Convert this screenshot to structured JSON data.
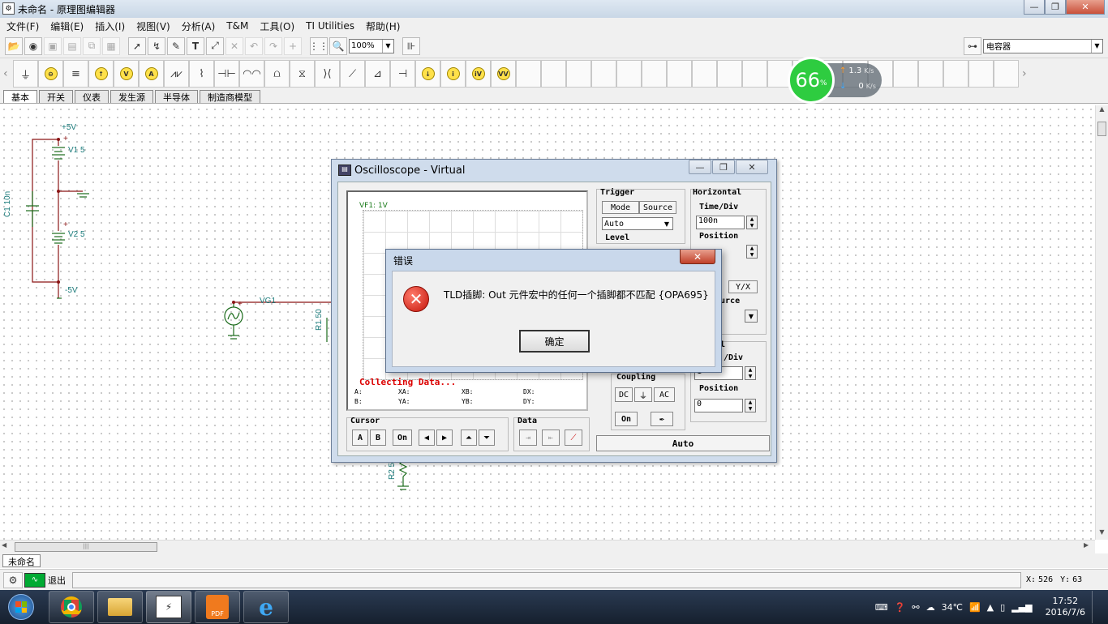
{
  "window": {
    "title": "未命名 - 原理图编辑器"
  },
  "menu": [
    "文件(F)",
    "编辑(E)",
    "插入(I)",
    "视图(V)",
    "分析(A)",
    "T&M",
    "工具(O)",
    "TI Utilities",
    "帮助(H)"
  ],
  "toolbar": {
    "zoom": "100%",
    "search_value": "电容器"
  },
  "component_tabs": [
    "基本",
    "开关",
    "仪表",
    "发生源",
    "半导体",
    "制造商模型"
  ],
  "speed_widget": {
    "percent": "66",
    "percent_sign": "%",
    "up": "1.3",
    "up_unit": "K/s",
    "down": "0",
    "down_unit": "K/s"
  },
  "schematic": {
    "plus5": "+5V",
    "v1": "V1 5",
    "c1": "C1 10n",
    "v2": "V2 5",
    "minus5": "-5V",
    "vg1": "VG1",
    "r1": "R1 50",
    "r2": "R2 5",
    "plus": "+"
  },
  "oscilloscope": {
    "title": "Oscilloscope - Virtual",
    "screen_label": "VF1: 1V",
    "collecting": "Collecting Data...",
    "readouts": {
      "a": "A:",
      "xa": "XA:",
      "xb": "XB:",
      "dx": "DX:",
      "b": "B:",
      "ya": "YA:",
      "yb": "YB:",
      "dy": "DY:"
    },
    "trigger": {
      "label": "Trigger",
      "mode": "Mode",
      "source": "Source",
      "mode_value": "Auto",
      "level": "Level"
    },
    "horizontal": {
      "label": "Horizontal",
      "time_div": "Time/Div",
      "time_value": "100n",
      "position": "Position",
      "yx": "Y/X",
      "source": "ource"
    },
    "vertical": {
      "label": "al",
      "div": "/Div",
      "div_value": "1",
      "position": "Position",
      "position_value": "0"
    },
    "coupling": {
      "label": "Coupling",
      "dc": "DC",
      "gnd": "⏚",
      "ac": "AC",
      "on": "On"
    },
    "cursor": {
      "label": "Cursor",
      "a": "A",
      "b": "B",
      "on": "On"
    },
    "data": {
      "label": "Data"
    },
    "auto": "Auto"
  },
  "error_dialog": {
    "title": "错误",
    "message": "TLD插脚: Out 元件宏中的任何一个插脚都不匹配 {OPA695}",
    "ok": "确定"
  },
  "doc_tab": "未命名",
  "statusbar": {
    "exit": "退出",
    "x_label": "X:",
    "x": "526",
    "y_label": "Y:",
    "y": "63"
  },
  "taskbar": {
    "temp": "34℃",
    "time": "17:52",
    "date": "2016/7/6"
  }
}
